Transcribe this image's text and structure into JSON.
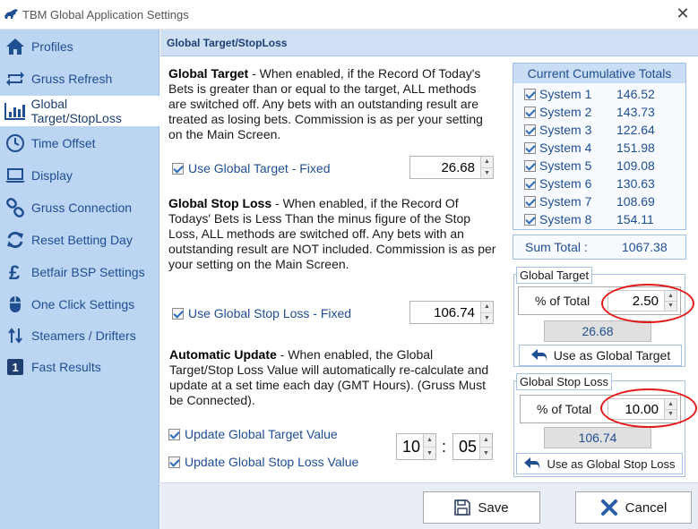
{
  "window": {
    "title": "TBM Global Application Settings",
    "close_glyph": "✕"
  },
  "sidebar": {
    "items": [
      {
        "label": "Profiles",
        "icon": "home-icon"
      },
      {
        "label": "Gruss Refresh",
        "icon": "refresh-arrows-icon"
      },
      {
        "label": "Global Target/StopLoss",
        "icon": "bar-chart-icon",
        "active": true
      },
      {
        "label": "Time Offset",
        "icon": "clock-icon"
      },
      {
        "label": "Display",
        "icon": "laptop-icon"
      },
      {
        "label": "Gruss Connection",
        "icon": "link-icon"
      },
      {
        "label": "Reset Betting Day",
        "icon": "sync-icon"
      },
      {
        "label": "Betfair BSP Settings",
        "icon": "pound-icon"
      },
      {
        "label": "One Click Settings",
        "icon": "mouse-icon"
      },
      {
        "label": "Steamers / Drifters",
        "icon": "up-down-arrows-icon"
      },
      {
        "label": "Fast Results",
        "icon": "number-one-icon"
      }
    ]
  },
  "panel": {
    "title": "Global Target/StopLoss"
  },
  "global_target": {
    "heading": "Global Target",
    "text": " - When enabled,  if the Record Of Today's Bets is greater than or equal to the target, ALL methods are switched off. Any bets with an outstanding result are treated as losing bets. Commission is as per your setting  on the Main Screen.",
    "checkbox_label": "Use Global Target - Fixed",
    "value": "26.68"
  },
  "global_stop_loss": {
    "heading": "Global Stop Loss",
    "text": " - When enabled,  if the Record Of Todays' Bets is Less Than the minus figure of the Stop Loss, ALL methods are switched off. Any bets with an outstanding  result are NOT included. Commission is as per your setting  on the Main Screen.",
    "checkbox_label": "Use Global Stop Loss - Fixed",
    "value": "106.74"
  },
  "automatic_update": {
    "heading": "Automatic Update",
    "text": " - When enabled, the Global Target/Stop Loss Value will automatically re-calculate and update at a set time each day (GMT Hours). (Gruss Must be Connected).",
    "update_target_label": "Update Global Target Value",
    "update_stoploss_label": "Update Global Stop Loss Value",
    "hour": "10",
    "separator": ":",
    "minute": "05"
  },
  "totals": {
    "header": "Current Cumulative Totals",
    "systems": [
      {
        "name": "System 1",
        "value": "146.52"
      },
      {
        "name": "System 2",
        "value": "143.73"
      },
      {
        "name": "System 3",
        "value": "122.64"
      },
      {
        "name": "System 4",
        "value": "151.98"
      },
      {
        "name": "System 5",
        "value": "109.08"
      },
      {
        "name": "System 6",
        "value": "130.63"
      },
      {
        "name": "System 7",
        "value": "108.69"
      },
      {
        "name": "System 8",
        "value": "154.11"
      }
    ],
    "sum_label": "Sum Total :",
    "sum_value": "1067.38"
  },
  "target_group": {
    "legend": "Global Target",
    "pct_label": "% of Total",
    "pct_value": "2.50",
    "computed": "26.68",
    "button_label": "Use as Global Target"
  },
  "stoploss_group": {
    "legend": "Global Stop Loss",
    "pct_label": "% of Total",
    "pct_value": "10.00",
    "computed": "106.74",
    "button_label": "Use as Global Stop Loss"
  },
  "footer": {
    "save_label": "Save",
    "cancel_label": "Cancel"
  },
  "colors": {
    "sidebar_bg": "#bcd5f3",
    "accent": "#1f4e91",
    "highlight": "#e21a1a"
  }
}
